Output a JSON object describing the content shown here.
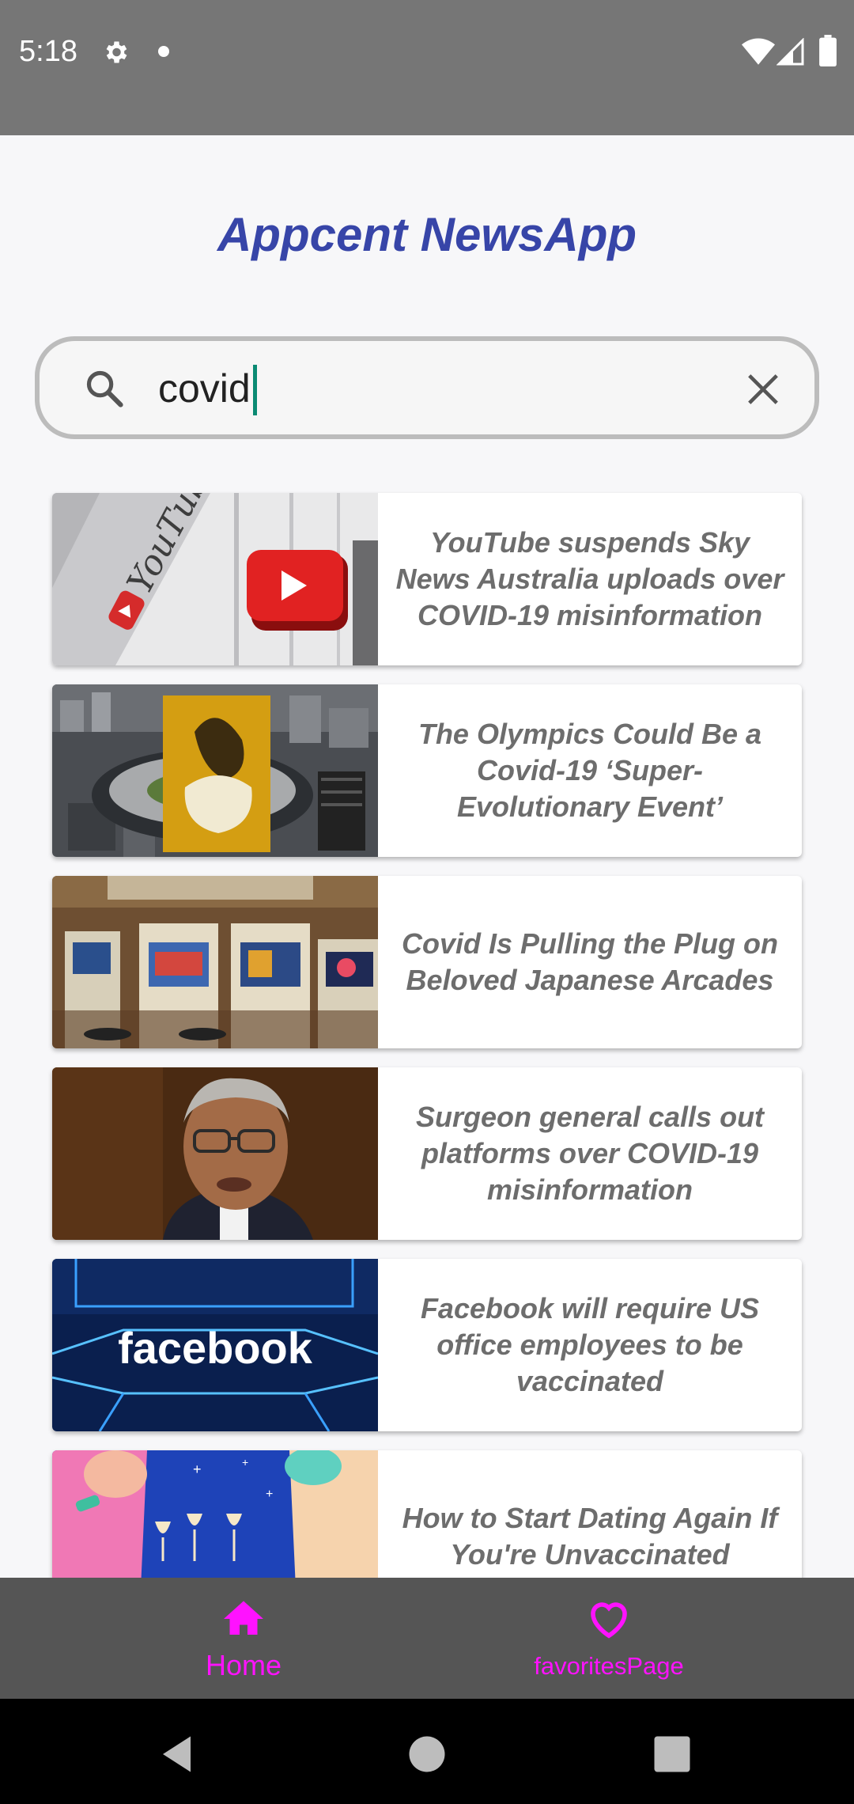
{
  "status_bar": {
    "time": "5:18",
    "icons": [
      "gear-icon",
      "notification-dot-icon",
      "wifi-icon",
      "signal-icon",
      "battery-icon"
    ]
  },
  "header": {
    "title": "Appcent NewsApp",
    "title_color": "#3745a8"
  },
  "search": {
    "value": "covid",
    "icon": "search-icon",
    "clear_icon": "close-icon"
  },
  "news": [
    {
      "title": "YouTube suspends Sky News Australia uploads over COVID-19 misinformation",
      "thumbnail": "youtube-sign-thumbnail"
    },
    {
      "title": "The Olympics Could Be a Covid-19 ‘Super-Evolutionary Event’",
      "thumbnail": "olympic-stadium-thumbnail"
    },
    {
      "title": "Covid Is Pulling the Plug on Beloved Japanese Arcades",
      "thumbnail": "arcade-machines-thumbnail"
    },
    {
      "title": "Surgeon general calls out platforms over COVID-19 misinformation",
      "thumbnail": "surgeon-general-thumbnail"
    },
    {
      "title": "Facebook will require US office employees to be vaccinated",
      "thumbnail": "facebook-logo-thumbnail"
    },
    {
      "title": "How to Start Dating Again If You're Unvaccinated",
      "thumbnail": "dating-illustration-thumbnail"
    }
  ],
  "thumb_labels": {
    "youtube": "YouTube",
    "facebook": "facebook"
  },
  "bottom_nav": {
    "home_label": "Home",
    "favorites_label": "favoritesPage",
    "active_color": "#ff12ff"
  },
  "system_nav": [
    "back-icon",
    "home-circle-icon",
    "recents-icon"
  ]
}
